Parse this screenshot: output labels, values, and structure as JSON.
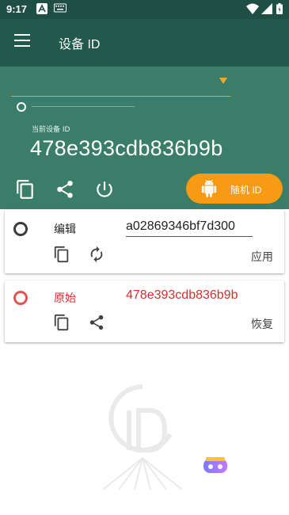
{
  "status_bar": {
    "time": "9:17"
  },
  "app_bar": {
    "title": "设备 ID"
  },
  "header": {
    "current_label": "当前设备 ID",
    "current_id": "478e393cdb836b9b",
    "random_button_label": "随机 ID"
  },
  "edit_card": {
    "name": "编辑",
    "value": "a02869346bf7d300",
    "action_label": "应用"
  },
  "original_card": {
    "name": "原始",
    "value": "478e393cdb836b9b",
    "action_label": "恢复"
  },
  "colors": {
    "status_bar": "#1f4e44",
    "app_bar": "#215a4c",
    "header": "#3a7e6a",
    "accent_orange": "#f79a14",
    "original_red": "#d32f2f"
  }
}
